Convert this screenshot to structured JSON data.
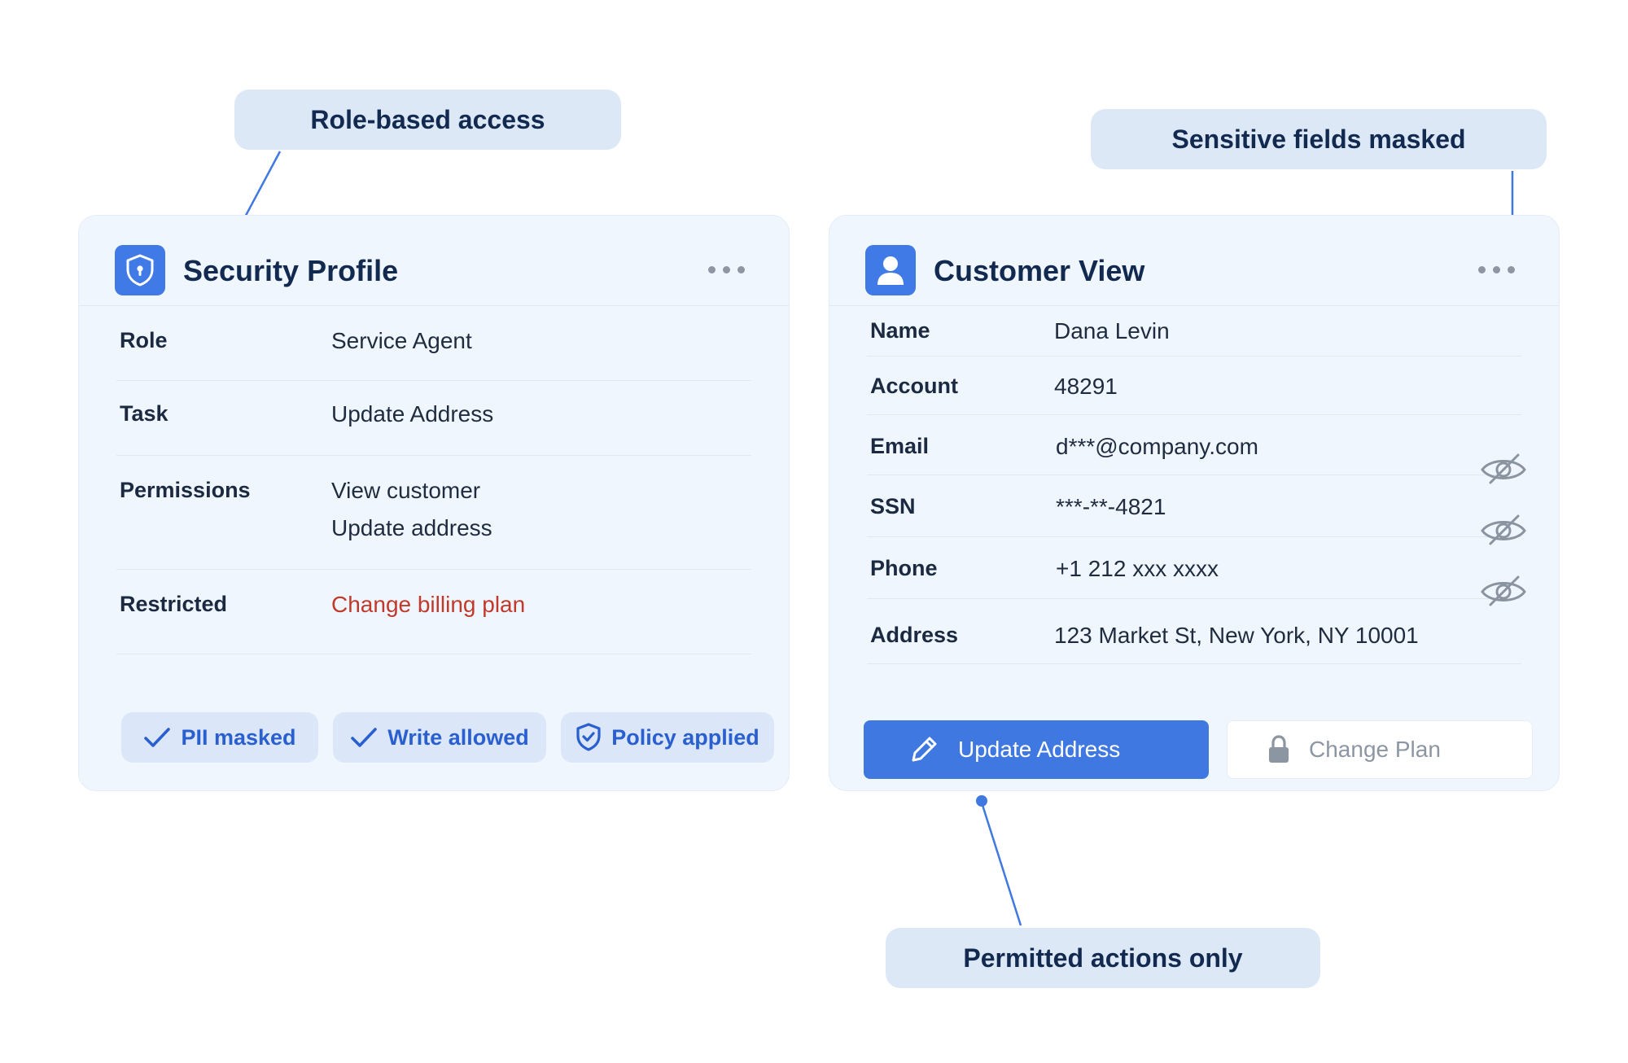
{
  "callouts": {
    "role_based": "Role-based access",
    "sensitive": "Sensitive fields masked",
    "permitted": "Permitted actions only"
  },
  "security_profile": {
    "title": "Security Profile",
    "rows": [
      {
        "label": "Role",
        "value": "Service Agent"
      },
      {
        "label": "Task",
        "value": "Update Address"
      },
      {
        "label": "Permissions",
        "values": [
          "View customer",
          "Update address"
        ]
      },
      {
        "label": "Restricted",
        "value": "Change billing plan"
      }
    ],
    "chips": [
      "PII masked",
      "Write allowed",
      "Policy applied"
    ]
  },
  "customer_view": {
    "title": "Customer View",
    "fields": [
      {
        "label": "Name",
        "value": "Dana Levin"
      },
      {
        "label": "Account",
        "value": "48291"
      },
      {
        "label": "Email",
        "value": "d***@company.com"
      },
      {
        "label": "SSN",
        "value": "***-**-4821"
      },
      {
        "label": "Phone",
        "value": "+1 212 xxx xxxx"
      },
      {
        "label": "Address",
        "value": "123 Market St, New York, NY 10001"
      }
    ],
    "buttons": {
      "update": "Update Address",
      "change_plan": "Change Plan"
    }
  },
  "icons": {
    "shield": "shield-icon",
    "user": "user-icon",
    "more": "more-icon",
    "check": "check-icon",
    "eye_off": "eye-off-icon",
    "pencil": "pencil-icon",
    "lock": "lock-icon"
  },
  "colors": {
    "accent": "#3f78e0",
    "restricted": "#c0392b",
    "callout_bg": "#dde8f7",
    "card_bg": "#f0f6fd"
  }
}
